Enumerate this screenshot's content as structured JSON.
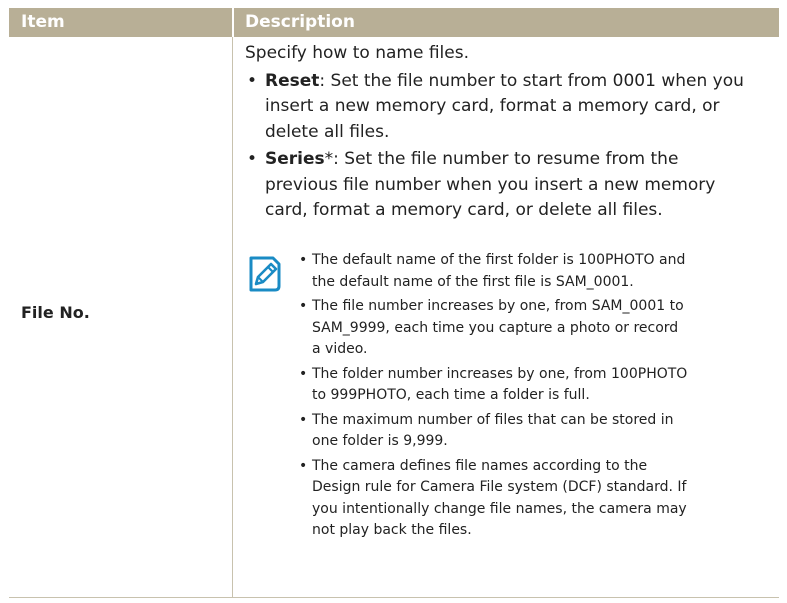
{
  "table": {
    "header": {
      "item": "Item",
      "description": "Description"
    },
    "row": {
      "item": "File No.",
      "intro": "Specify how to name files.",
      "bullets": [
        {
          "term": "Reset",
          "suffix": ":",
          "lines": [
            " Set the file number to start from 0001 when you",
            "insert a new memory card, format a memory card, or",
            "delete all files."
          ]
        },
        {
          "term": "Series",
          "suffix": "*:",
          "lines": [
            " Set the file number to resume from the",
            "previous file number when you insert a new memory",
            "card, format a memory card, or delete all files."
          ]
        }
      ],
      "note_icon": "note-pencil-icon",
      "notes": [
        {
          "lines": [
            "The default name of the first folder is 100PHOTO and",
            "the default name of the first file is SAM_0001."
          ]
        },
        {
          "lines": [
            "The file number increases by one, from SAM_0001 to",
            "SAM_9999, each time you capture a photo or record",
            "a video."
          ]
        },
        {
          "lines": [
            "The folder number increases by one, from 100PHOTO",
            "to 999PHOTO, each time a folder is full."
          ]
        },
        {
          "lines": [
            "The maximum number of files that can be stored in",
            "one folder is 9,999."
          ]
        },
        {
          "lines": [
            "The camera defines file names according to the",
            "Design rule for Camera File system (DCF) standard. If",
            "you intentionally change file names, the camera may",
            "not play back the files."
          ]
        }
      ]
    }
  },
  "colors": {
    "header_bg": "#b8af96",
    "accent_icon": "#1a8bc4",
    "divider": "#c8c2ae"
  }
}
